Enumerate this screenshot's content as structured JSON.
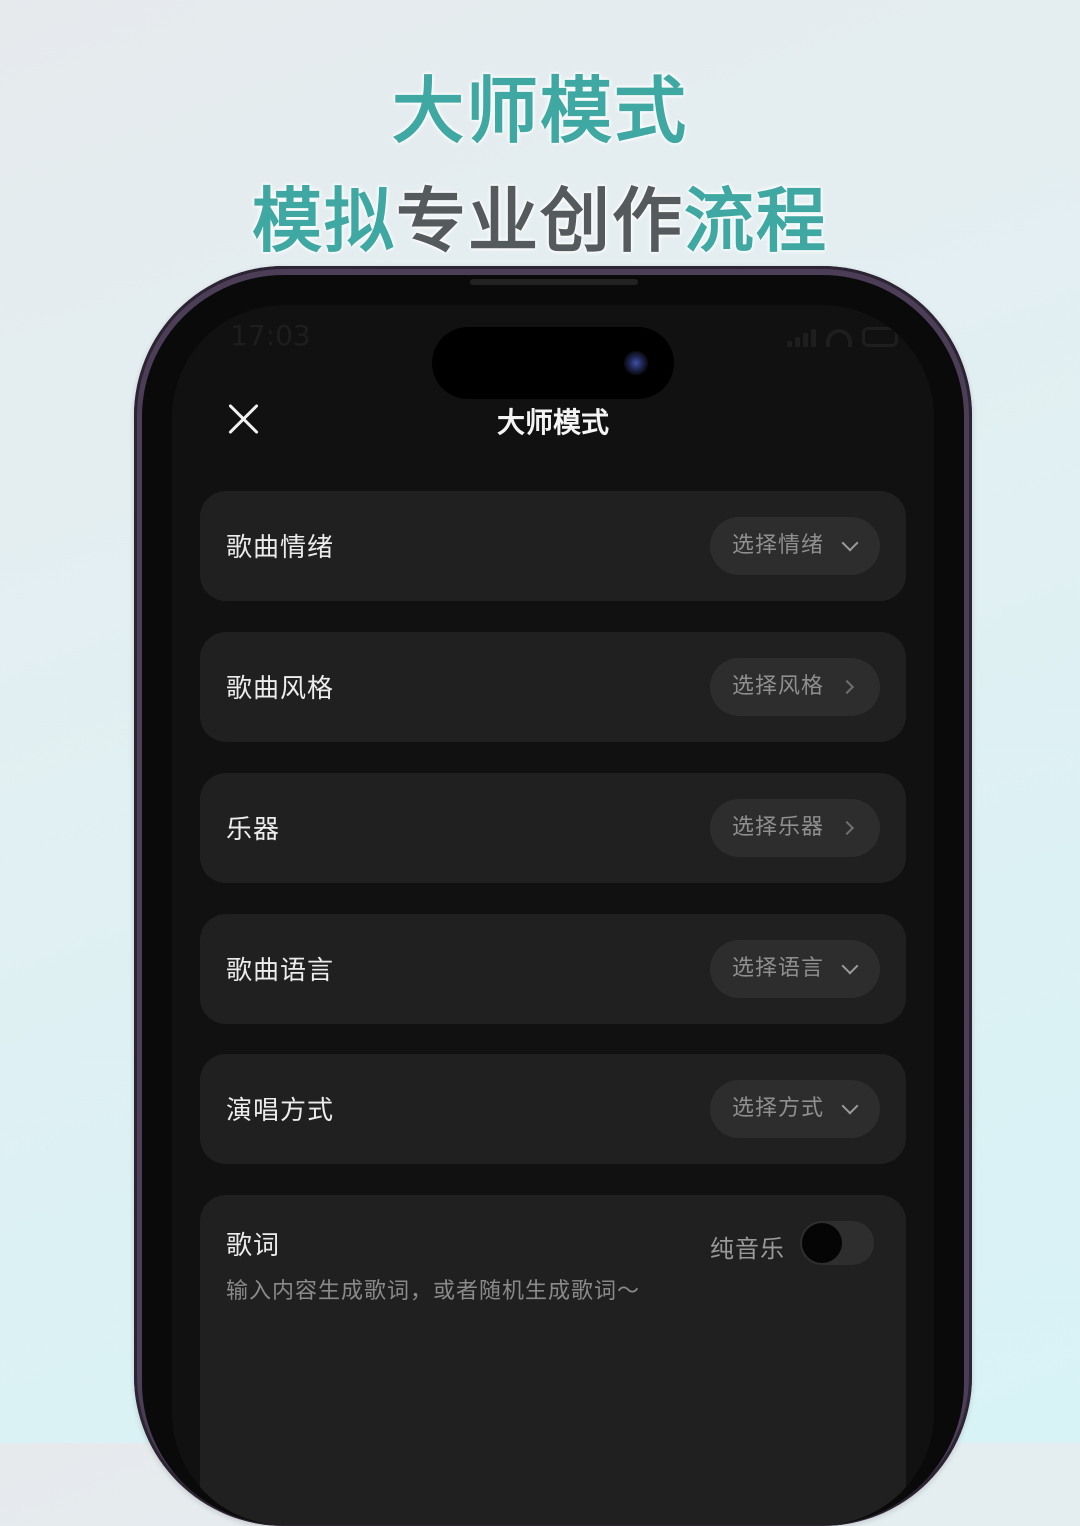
{
  "promo": {
    "headline_line1": "大师模式",
    "headline_line2_accent_a": "模拟",
    "headline_line2_main": "专业创作",
    "headline_line2_accent_b": "流程"
  },
  "status_bar": {
    "time": "17:03",
    "icons": [
      "signal-icon",
      "wifi-icon",
      "battery-icon"
    ]
  },
  "nav": {
    "title": "大师模式",
    "close_icon": "close-icon"
  },
  "options": [
    {
      "label": "歌曲情绪",
      "selector": "选择情绪",
      "chevron": "chevron-down-icon"
    },
    {
      "label": "歌曲风格",
      "selector": "选择风格",
      "chevron": "chevron-right-icon"
    },
    {
      "label": "乐器",
      "selector": "选择乐器",
      "chevron": "chevron-right-icon"
    },
    {
      "label": "歌曲语言",
      "selector": "选择语言",
      "chevron": "chevron-down-icon"
    },
    {
      "label": "演唱方式",
      "selector": "选择方式",
      "chevron": "chevron-down-icon"
    }
  ],
  "lyrics": {
    "title": "歌词",
    "pure_music_label": "纯音乐",
    "pure_music_enabled": false,
    "placeholder": "输入内容生成歌词，或者随机生成歌词～"
  },
  "colors": {
    "accent": "#3fa8a2",
    "headline_gray": "#555a5c",
    "screen_bg": "#111112",
    "card_bg": "#202021",
    "selector_bg": "#2d2d2e"
  }
}
